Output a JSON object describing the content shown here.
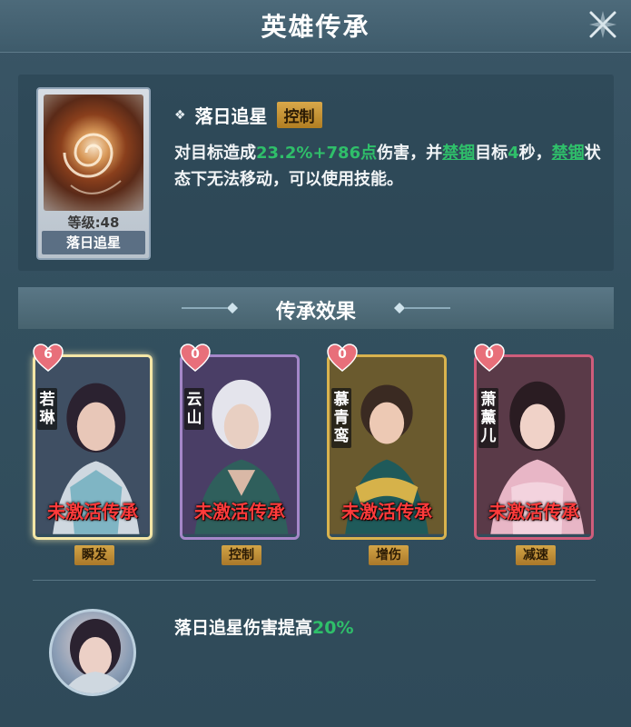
{
  "window": {
    "title": "英雄传承",
    "close_icon": "close-x-icon"
  },
  "skill": {
    "name": "落日追星",
    "bullet": "❖",
    "tag": "控制",
    "level_text": "等级:48",
    "card_name": "落日追星",
    "description": {
      "p1": "对目标造成",
      "dmg": "23.2%+786点",
      "p2": "伤害，并",
      "link1": "禁锢",
      "p3": "目标",
      "secs": "4",
      "p4": "秒，",
      "link2": "禁锢",
      "p5": "状态下无法移动，可以使用技能。"
    }
  },
  "inherit": {
    "title": "传承效果",
    "heroes": [
      {
        "name": "若琳",
        "count": "6",
        "status": "未激活传承",
        "tag": "瞬发",
        "color": "#f4e6a6"
      },
      {
        "name": "云山",
        "count": "0",
        "status": "未激活传承",
        "tag": "控制",
        "color": "#a587c9"
      },
      {
        "name": "慕青鸾",
        "count": "0",
        "status": "未激活传承",
        "tag": "增伤",
        "color": "#d9b34e"
      },
      {
        "name": "萧薰儿",
        "count": "0",
        "status": "未激活传承",
        "tag": "减速",
        "color": "#cf5d7b"
      }
    ]
  },
  "effect": {
    "text_prefix": "落日追星伤害提高",
    "value": "20%"
  },
  "colors": {
    "accent_green": "#2fbf6a",
    "inactive_red": "#ff3b3b",
    "tag_gold": "#c8973a"
  }
}
